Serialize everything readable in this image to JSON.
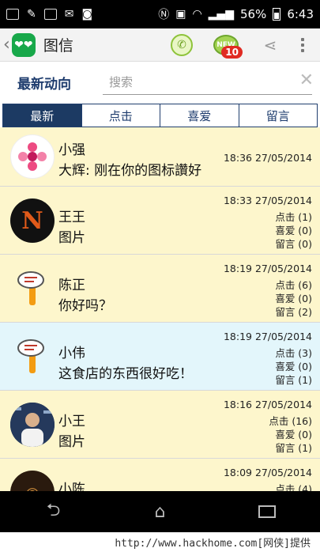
{
  "status_bar": {
    "battery": "56%",
    "time": "6:43"
  },
  "app_bar": {
    "title": "图信",
    "new_badge_label": "NEW",
    "badge_count": "10"
  },
  "header": {
    "title": "最新动向",
    "search_placeholder": "搜索"
  },
  "tabs": [
    {
      "label": "最新",
      "active": true
    },
    {
      "label": "点击",
      "active": false
    },
    {
      "label": "喜爱",
      "active": false
    },
    {
      "label": "留言",
      "active": false
    }
  ],
  "feed": [
    {
      "name": "小强",
      "message": "大辉: 刚在你的图标讚好",
      "time": "18:36 27/05/2014",
      "stats": [],
      "bg": "yellow",
      "avatar": "flower"
    },
    {
      "name": "王王",
      "message": "图片",
      "time": "18:33 27/05/2014",
      "stats": [
        "点击 (1)",
        "喜爱 (0)",
        "留言 (0)"
      ],
      "bg": "yellow",
      "avatar": "letter-n"
    },
    {
      "name": "陈正",
      "message": "你好吗？",
      "time": "18:19 27/05/2014",
      "stats": [
        "点击 (6)",
        "喜爱 (0)",
        "留言 (2)"
      ],
      "bg": "yellow",
      "avatar": "chat-pin"
    },
    {
      "name": "小伟",
      "message": "这食店的东西很好吃！",
      "time": "18:19 27/05/2014",
      "stats": [
        "点击 (3)",
        "喜爱 (0)",
        "留言 (1)"
      ],
      "bg": "blue",
      "avatar": "chat-pin"
    },
    {
      "name": "小王",
      "message": "图片",
      "time": "18:16 27/05/2014",
      "stats": [
        "点击 (16)",
        "喜爱 (0)",
        "留言 (1)"
      ],
      "bg": "yellow",
      "avatar": "photo"
    },
    {
      "name": "小陈",
      "message": "",
      "time": "18:09 27/05/2014",
      "stats": [
        "点击 (4)"
      ],
      "bg": "yellow",
      "avatar": "dark"
    }
  ],
  "footer": {
    "watermark": "http://www.hackhome.com[网侠]提供"
  }
}
